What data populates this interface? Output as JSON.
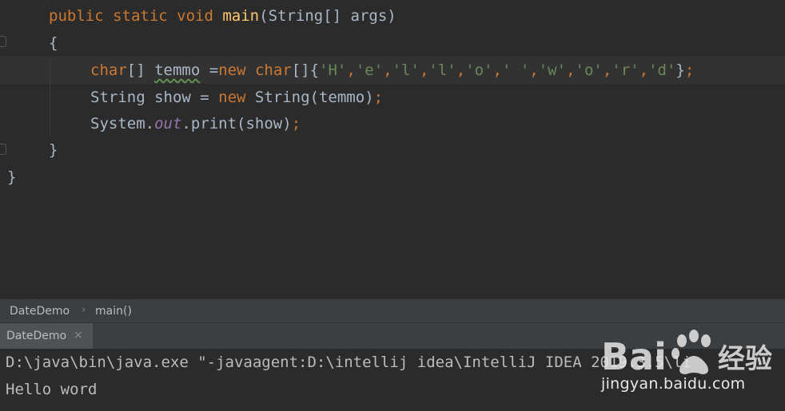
{
  "editor": {
    "lines": [
      {
        "parts": [
          {
            "text": "public ",
            "cls": "kw"
          },
          {
            "text": "static ",
            "cls": "kw"
          },
          {
            "text": "void ",
            "cls": "kw"
          },
          {
            "text": "main",
            "cls": "fn"
          },
          {
            "text": "(String[] args)",
            "cls": ""
          }
        ]
      },
      {
        "parts": [
          {
            "text": "{",
            "cls": ""
          }
        ]
      },
      {
        "parts": [
          {
            "text": "char",
            "cls": "kw"
          },
          {
            "text": "[] ",
            "cls": ""
          },
          {
            "text": "temmo",
            "cls": "squiggle"
          },
          {
            "text": " =",
            "cls": ""
          },
          {
            "text": "new ",
            "cls": "kw"
          },
          {
            "text": "char",
            "cls": "kw"
          },
          {
            "text": "[]{",
            "cls": ""
          },
          {
            "text": "'H'",
            "cls": "str"
          },
          {
            "text": ",",
            "cls": "kw"
          },
          {
            "text": "'e'",
            "cls": "str"
          },
          {
            "text": ",",
            "cls": "kw"
          },
          {
            "text": "'l'",
            "cls": "str"
          },
          {
            "text": ",",
            "cls": "kw"
          },
          {
            "text": "'l'",
            "cls": "str"
          },
          {
            "text": ",",
            "cls": "kw"
          },
          {
            "text": "'o'",
            "cls": "str"
          },
          {
            "text": ",",
            "cls": "kw"
          },
          {
            "text": "' '",
            "cls": "str"
          },
          {
            "text": ",",
            "cls": "kw"
          },
          {
            "text": "'w'",
            "cls": "str"
          },
          {
            "text": ",",
            "cls": "kw"
          },
          {
            "text": "'o'",
            "cls": "str"
          },
          {
            "text": ",",
            "cls": "kw"
          },
          {
            "text": "'r'",
            "cls": "str"
          },
          {
            "text": ",",
            "cls": "kw"
          },
          {
            "text": "'d'",
            "cls": "str"
          },
          {
            "text": "}",
            "cls": ""
          },
          {
            "text": ";",
            "cls": "kw"
          }
        ]
      },
      {
        "parts": [
          {
            "text": "String show = ",
            "cls": ""
          },
          {
            "text": "new ",
            "cls": "kw"
          },
          {
            "text": "String(temmo)",
            "cls": ""
          },
          {
            "text": ";",
            "cls": "kw"
          }
        ]
      },
      {
        "parts": [
          {
            "text": "System.",
            "cls": ""
          },
          {
            "text": "out",
            "cls": "field"
          },
          {
            "text": ".print(show)",
            "cls": ""
          },
          {
            "text": ";",
            "cls": "kw"
          }
        ]
      },
      {
        "parts": [
          {
            "text": "}",
            "cls": ""
          }
        ]
      },
      {
        "parts": [
          {
            "text": "}",
            "cls": ""
          }
        ]
      }
    ]
  },
  "breadcrumb": {
    "items": [
      "DateDemo",
      "main()"
    ],
    "separator": "›"
  },
  "run_panel": {
    "tab_label": "DateDemo",
    "tab_close": "×",
    "console_lines": [
      "D:\\java\\bin\\java.exe \"-javaagent:D:\\intellij idea\\IntelliJ IDEA 2019.3.5\\li",
      "Hello word"
    ]
  },
  "watermark": {
    "logo_text": "Bai",
    "logo_text_2": "经验",
    "url": "jingyan.baidu.com"
  },
  "colors": {
    "background": "#2b2b2b",
    "keyword": "#cc7832",
    "function": "#ffc66d",
    "string": "#6a8759",
    "field": "#9876aa",
    "text": "#a9b7c6"
  }
}
